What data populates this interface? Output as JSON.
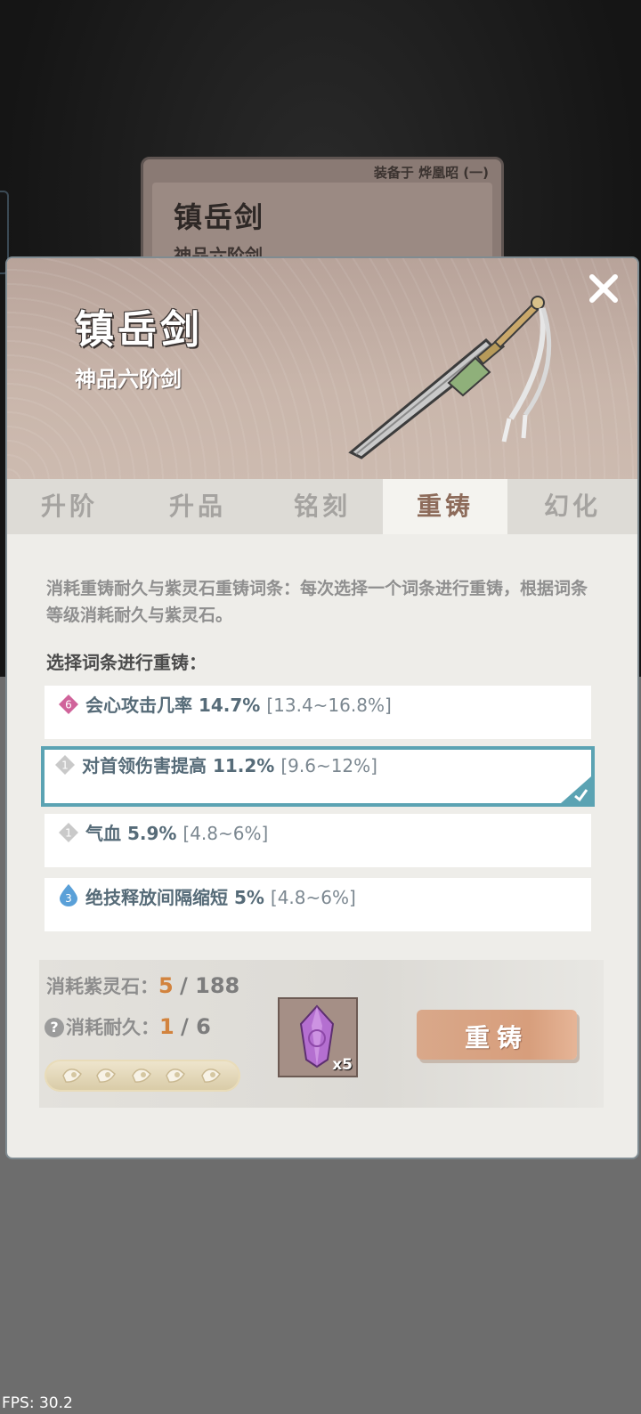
{
  "background_card": {
    "equipped_label": "装备于 烨凰昭 (一)",
    "name": "镇岳剑",
    "subtitle": "神品六阶剑"
  },
  "header": {
    "name": "镇岳剑",
    "subtitle": "神品六阶剑",
    "close_icon": "close-icon"
  },
  "tabs": [
    {
      "label": "升阶",
      "active": false
    },
    {
      "label": "升品",
      "active": false
    },
    {
      "label": "铭刻",
      "active": false
    },
    {
      "label": "重铸",
      "active": true
    },
    {
      "label": "幻化",
      "active": false
    }
  ],
  "description": "消耗重铸耐久与紫灵石重铸词条：每次选择一个词条进行重铸，根据词条等级消耗耐久与紫灵石。",
  "prompt": "选择词条进行重铸：",
  "entries": [
    {
      "level": "6",
      "text": "会心攻击几率 14.7%",
      "range": "[13.4~16.8%]",
      "badge_color": "#d0639a",
      "selected": false
    },
    {
      "level": "1",
      "text": "对首领伤害提高 11.2%",
      "range": "[9.6~12%]",
      "badge_color": "#c9c9c9",
      "selected": true
    },
    {
      "level": "1",
      "text": "气血 5.9%",
      "range": "[4.8~6%]",
      "badge_color": "#c9c9c9",
      "selected": false
    },
    {
      "level": "3",
      "text": "绝技释放间隔缩短 5%",
      "range": "[4.8~6%]",
      "badge_color": "#5aa0d8",
      "selected": false
    }
  ],
  "cost": {
    "stone_label": "消耗紫灵石：",
    "stone_current": "5",
    "stone_total": "/ 188",
    "durability_label": "消耗耐久：",
    "durability_current": "1",
    "durability_total": "/ 6",
    "help_icon": "?",
    "durability_pips": 5
  },
  "item": {
    "icon": "purple-crystal-icon",
    "count": "x5"
  },
  "reforge_button": "重铸",
  "fps": "FPS: 30.2",
  "colors": {
    "accent_orange": "#d2833e",
    "selected_border": "#5ba3b3",
    "button": "#d79e7c"
  }
}
